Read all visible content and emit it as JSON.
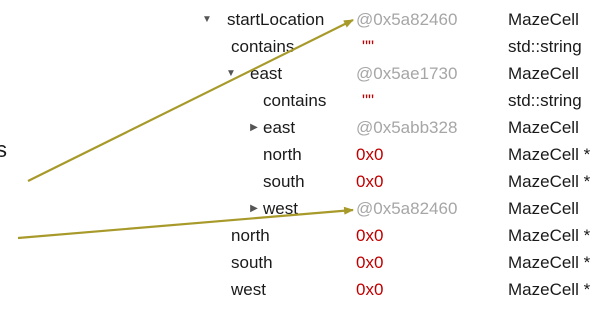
{
  "edge_fragment": "s",
  "colors": {
    "address": "#a6a6a6",
    "null_pointer": "#c00000",
    "string_value": "#c00000",
    "arrow": "#a89a2a"
  },
  "rows": [
    {
      "name": "startLocation",
      "value": "@0x5a82460",
      "type": "MazeCell",
      "toggle": "expanded"
    },
    {
      "name": "contains",
      "value": "\"\"",
      "type": "std::string",
      "toggle": "none"
    },
    {
      "name": "east",
      "value": "@0x5ae1730",
      "type": "MazeCell",
      "toggle": "expanded"
    },
    {
      "name": "contains",
      "value": "\"\"",
      "type": "std::string",
      "toggle": "none"
    },
    {
      "name": "east",
      "value": "@0x5abb328",
      "type": "MazeCell",
      "toggle": "collapsed"
    },
    {
      "name": "north",
      "value": "0x0",
      "type": "MazeCell *",
      "toggle": "none"
    },
    {
      "name": "south",
      "value": "0x0",
      "type": "MazeCell *",
      "toggle": "none"
    },
    {
      "name": "west",
      "value": "@0x5a82460",
      "type": "MazeCell",
      "toggle": "collapsed"
    },
    {
      "name": "north",
      "value": "0x0",
      "type": "MazeCell *",
      "toggle": "none"
    },
    {
      "name": "south",
      "value": "0x0",
      "type": "MazeCell *",
      "toggle": "none"
    },
    {
      "name": "west",
      "value": "0x0",
      "type": "MazeCell *",
      "toggle": "none"
    }
  ],
  "toggle_icons": {
    "expanded": "expand-triangle-down-icon",
    "collapsed": "collapse-triangle-right-icon"
  }
}
